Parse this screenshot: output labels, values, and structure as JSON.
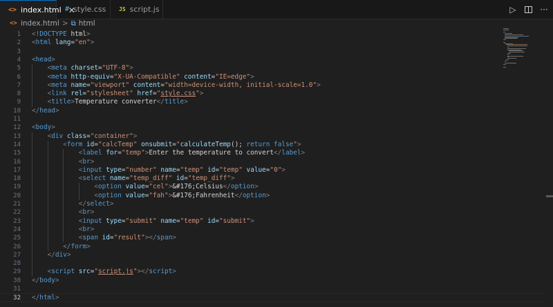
{
  "tabs": [
    {
      "icon": "<>",
      "label": "index.html",
      "active": true,
      "close": "✕"
    },
    {
      "icon": "#",
      "label": "style.css",
      "active": false
    },
    {
      "icon": "JS",
      "label": "script.js",
      "active": false
    }
  ],
  "breadcrumb": {
    "icon": "<>",
    "file": "index.html",
    "separator": ">",
    "symbol_icon": "⧉",
    "symbol": "html"
  },
  "toolbar": {
    "run": "▷",
    "more": "···"
  },
  "current_line": 32,
  "lines": [
    {
      "n": "1",
      "segs": [
        [
          "p",
          "<"
        ],
        [
          "t",
          "!DOCTYPE"
        ],
        [
          "a",
          " "
        ],
        [
          "x",
          "html"
        ],
        [
          "p",
          ">"
        ]
      ]
    },
    {
      "n": "2",
      "segs": [
        [
          "p",
          "<"
        ],
        [
          "t",
          "html"
        ],
        [
          "a",
          " lang"
        ],
        [
          "x",
          "="
        ],
        [
          "s",
          "\"en\""
        ],
        [
          "p",
          ">"
        ]
      ]
    },
    {
      "n": "3",
      "segs": []
    },
    {
      "n": "4",
      "segs": [
        [
          "p",
          "<"
        ],
        [
          "t",
          "head"
        ],
        [
          "p",
          ">"
        ]
      ]
    },
    {
      "n": "5",
      "segs": [
        [
          "x",
          "    "
        ],
        [
          "p",
          "<"
        ],
        [
          "t",
          "meta"
        ],
        [
          "a",
          " charset"
        ],
        [
          "x",
          "="
        ],
        [
          "s",
          "\"UTF-8\""
        ],
        [
          "p",
          ">"
        ]
      ]
    },
    {
      "n": "6",
      "segs": [
        [
          "x",
          "    "
        ],
        [
          "p",
          "<"
        ],
        [
          "t",
          "meta"
        ],
        [
          "a",
          " http-equiv"
        ],
        [
          "x",
          "="
        ],
        [
          "s",
          "\"X-UA-Compatible\""
        ],
        [
          "a",
          " content"
        ],
        [
          "x",
          "="
        ],
        [
          "s",
          "\"IE=edge\""
        ],
        [
          "p",
          ">"
        ]
      ]
    },
    {
      "n": "7",
      "segs": [
        [
          "x",
          "    "
        ],
        [
          "p",
          "<"
        ],
        [
          "t",
          "meta"
        ],
        [
          "a",
          " name"
        ],
        [
          "x",
          "="
        ],
        [
          "s",
          "\"viewport\""
        ],
        [
          "a",
          " content"
        ],
        [
          "x",
          "="
        ],
        [
          "s",
          "\"width=device-width, initial-scale=1.0\""
        ],
        [
          "p",
          ">"
        ]
      ]
    },
    {
      "n": "8",
      "segs": [
        [
          "x",
          "    "
        ],
        [
          "p",
          "<"
        ],
        [
          "t",
          "link"
        ],
        [
          "a",
          " rel"
        ],
        [
          "x",
          "="
        ],
        [
          "s",
          "\"stylesheet\""
        ],
        [
          "a",
          " href"
        ],
        [
          "x",
          "="
        ],
        [
          "s",
          "\""
        ],
        [
          "su",
          "style.css"
        ],
        [
          "s",
          "\""
        ],
        [
          "p",
          ">"
        ]
      ]
    },
    {
      "n": "9",
      "segs": [
        [
          "x",
          "    "
        ],
        [
          "p",
          "<"
        ],
        [
          "t",
          "title"
        ],
        [
          "p",
          ">"
        ],
        [
          "x",
          "Temperature converter"
        ],
        [
          "p",
          "</"
        ],
        [
          "t",
          "title"
        ],
        [
          "p",
          ">"
        ]
      ]
    },
    {
      "n": "10",
      "segs": [
        [
          "p",
          "</"
        ],
        [
          "t",
          "head"
        ],
        [
          "p",
          ">"
        ]
      ]
    },
    {
      "n": "11",
      "segs": []
    },
    {
      "n": "12",
      "segs": [
        [
          "p",
          "<"
        ],
        [
          "t",
          "body"
        ],
        [
          "p",
          ">"
        ]
      ]
    },
    {
      "n": "13",
      "segs": [
        [
          "x",
          "    "
        ],
        [
          "p",
          "<"
        ],
        [
          "t",
          "div"
        ],
        [
          "a",
          " class"
        ],
        [
          "x",
          "="
        ],
        [
          "s",
          "\"container\""
        ],
        [
          "p",
          ">"
        ]
      ]
    },
    {
      "n": "14",
      "segs": [
        [
          "x",
          "        "
        ],
        [
          "p",
          "<"
        ],
        [
          "t",
          "form"
        ],
        [
          "a",
          " id"
        ],
        [
          "x",
          "="
        ],
        [
          "s",
          "\"calcTemp\""
        ],
        [
          "a",
          " onsubmit"
        ],
        [
          "x",
          "="
        ],
        [
          "s",
          "\""
        ],
        [
          "js",
          "calculateTemp"
        ],
        [
          "x",
          "(); "
        ],
        [
          "t",
          "return"
        ],
        [
          "x",
          " "
        ],
        [
          "t",
          "false"
        ],
        [
          "s",
          "\""
        ],
        [
          "p",
          ">"
        ]
      ]
    },
    {
      "n": "15",
      "segs": [
        [
          "x",
          "            "
        ],
        [
          "p",
          "<"
        ],
        [
          "t",
          "label"
        ],
        [
          "a",
          " for"
        ],
        [
          "x",
          "="
        ],
        [
          "s",
          "\"temp\""
        ],
        [
          "p",
          ">"
        ],
        [
          "x",
          "Enter the temperature to convert"
        ],
        [
          "p",
          "</"
        ],
        [
          "t",
          "label"
        ],
        [
          "p",
          ">"
        ]
      ]
    },
    {
      "n": "16",
      "segs": [
        [
          "x",
          "            "
        ],
        [
          "p",
          "<"
        ],
        [
          "t",
          "br"
        ],
        [
          "p",
          ">"
        ]
      ]
    },
    {
      "n": "17",
      "segs": [
        [
          "x",
          "            "
        ],
        [
          "p",
          "<"
        ],
        [
          "t",
          "input"
        ],
        [
          "a",
          " type"
        ],
        [
          "x",
          "="
        ],
        [
          "s",
          "\"number\""
        ],
        [
          "a",
          " name"
        ],
        [
          "x",
          "="
        ],
        [
          "s",
          "\"temp\""
        ],
        [
          "a",
          " id"
        ],
        [
          "x",
          "="
        ],
        [
          "s",
          "\"temp\""
        ],
        [
          "a",
          " value"
        ],
        [
          "x",
          "="
        ],
        [
          "s",
          "\"0\""
        ],
        [
          "p",
          ">"
        ]
      ]
    },
    {
      "n": "18",
      "segs": [
        [
          "x",
          "            "
        ],
        [
          "p",
          "<"
        ],
        [
          "t",
          "select"
        ],
        [
          "a",
          " name"
        ],
        [
          "x",
          "="
        ],
        [
          "s",
          "\"temp_diff\""
        ],
        [
          "a",
          " id"
        ],
        [
          "x",
          "="
        ],
        [
          "s",
          "\"temp_diff\""
        ],
        [
          "p",
          ">"
        ]
      ]
    },
    {
      "n": "19",
      "segs": [
        [
          "x",
          "                "
        ],
        [
          "p",
          "<"
        ],
        [
          "t",
          "option"
        ],
        [
          "a",
          " value"
        ],
        [
          "x",
          "="
        ],
        [
          "s",
          "\"cel\""
        ],
        [
          "p",
          ">"
        ],
        [
          "x",
          "&#176;Celsius"
        ],
        [
          "p",
          "</"
        ],
        [
          "t",
          "option"
        ],
        [
          "p",
          ">"
        ]
      ]
    },
    {
      "n": "20",
      "segs": [
        [
          "x",
          "                "
        ],
        [
          "p",
          "<"
        ],
        [
          "t",
          "option"
        ],
        [
          "a",
          " value"
        ],
        [
          "x",
          "="
        ],
        [
          "s",
          "\"fah\""
        ],
        [
          "p",
          ">"
        ],
        [
          "x",
          "&#176;Fahrenheit"
        ],
        [
          "p",
          "</"
        ],
        [
          "t",
          "option"
        ],
        [
          "p",
          ">"
        ]
      ]
    },
    {
      "n": "21",
      "segs": [
        [
          "x",
          "            "
        ],
        [
          "p",
          "</"
        ],
        [
          "t",
          "select"
        ],
        [
          "p",
          ">"
        ]
      ]
    },
    {
      "n": "22",
      "segs": [
        [
          "x",
          "            "
        ],
        [
          "p",
          "<"
        ],
        [
          "t",
          "br"
        ],
        [
          "p",
          ">"
        ]
      ]
    },
    {
      "n": "23",
      "segs": [
        [
          "x",
          "            "
        ],
        [
          "p",
          "<"
        ],
        [
          "t",
          "input"
        ],
        [
          "a",
          " type"
        ],
        [
          "x",
          "="
        ],
        [
          "s",
          "\"submit\""
        ],
        [
          "a",
          " name"
        ],
        [
          "x",
          "="
        ],
        [
          "s",
          "\"temp\""
        ],
        [
          "a",
          " id"
        ],
        [
          "x",
          "="
        ],
        [
          "s",
          "\"submit\""
        ],
        [
          "p",
          ">"
        ]
      ]
    },
    {
      "n": "24",
      "segs": [
        [
          "x",
          "            "
        ],
        [
          "p",
          "<"
        ],
        [
          "t",
          "br"
        ],
        [
          "p",
          ">"
        ]
      ]
    },
    {
      "n": "25",
      "segs": [
        [
          "x",
          "            "
        ],
        [
          "p",
          "<"
        ],
        [
          "t",
          "span"
        ],
        [
          "a",
          " id"
        ],
        [
          "x",
          "="
        ],
        [
          "s",
          "\"result\""
        ],
        [
          "p",
          "></"
        ],
        [
          "t",
          "span"
        ],
        [
          "p",
          ">"
        ]
      ]
    },
    {
      "n": "26",
      "segs": [
        [
          "x",
          "        "
        ],
        [
          "p",
          "</"
        ],
        [
          "t",
          "form"
        ],
        [
          "p",
          ">"
        ]
      ]
    },
    {
      "n": "27",
      "segs": [
        [
          "x",
          "    "
        ],
        [
          "p",
          "</"
        ],
        [
          "t",
          "div"
        ],
        [
          "p",
          ">"
        ]
      ]
    },
    {
      "n": "28",
      "segs": []
    },
    {
      "n": "29",
      "segs": [
        [
          "x",
          "    "
        ],
        [
          "p",
          "<"
        ],
        [
          "t",
          "script"
        ],
        [
          "a",
          " src"
        ],
        [
          "x",
          "="
        ],
        [
          "s",
          "\""
        ],
        [
          "su",
          "script.js"
        ],
        [
          "s",
          "\""
        ],
        [
          "p",
          "></"
        ],
        [
          "t",
          "script"
        ],
        [
          "p",
          ">"
        ]
      ]
    },
    {
      "n": "30",
      "segs": [
        [
          "p",
          "</"
        ],
        [
          "t",
          "body"
        ],
        [
          "p",
          ">"
        ]
      ]
    },
    {
      "n": "31",
      "segs": []
    },
    {
      "n": "32",
      "segs": [
        [
          "p",
          "</"
        ],
        [
          "t",
          "html"
        ],
        [
          "p",
          ">"
        ]
      ]
    }
  ],
  "colors": {
    "background": "#1f1f1f",
    "tag": "#569cd6",
    "attribute": "#9cdcfe",
    "string": "#ce9178",
    "punctuation": "#808080",
    "text": "#d4d4d4",
    "line_number": "#6e7681",
    "active_tab_border": "#0078d4",
    "html_icon": "#e37933",
    "css_icon": "#519aba",
    "js_icon": "#cbcb41"
  }
}
